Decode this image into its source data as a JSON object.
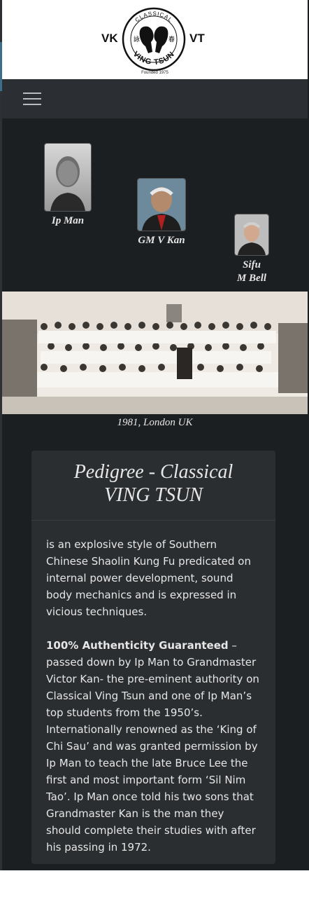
{
  "logo": {
    "left_text": "VK",
    "right_text": "VT",
    "seal_top_text": "CLASSICAL",
    "seal_bottom_text": "VING TSUN",
    "seal_char_left": "詠",
    "seal_char_right": "春",
    "founded": "Founded 1975"
  },
  "nav": {
    "menu_icon": "hamburger-menu-icon"
  },
  "portraits": [
    {
      "name_line1": "Ip Man",
      "name_line2": ""
    },
    {
      "name_line1": "GM V Kan",
      "name_line2": ""
    },
    {
      "name_line1": "Sifu",
      "name_line2": "M Bell"
    }
  ],
  "group_photo": {
    "caption": "1981, London UK"
  },
  "card": {
    "title_line1": "Pedigree - Classical",
    "title_line2": "VING TSUN",
    "intro": "is an explosive style of Southern Chinese Shaolin Kung Fu predicated on internal power development, sound body mechanics and is expressed in vicious techniques.",
    "guarantee_bold": "100% Authenticity Guaranteed",
    "guarantee_rest": " – passed down by Ip Man to Grandmaster Victor Kan- the pre-eminent authority on Classical Ving Tsun and one of Ip Man’s top students from the 1950’s. Internationally renowned as the ‘King of Chi Sau’ and was granted permission by Ip Man to teach the late Bruce Lee the first and most important form ‘Sil Nim Tao’. Ip Man once told his two sons that Grandmaster Kan is the man they should complete their studies with after his passing in 1972."
  },
  "colors": {
    "page_bg": "#1c1f22",
    "navbar_bg": "#2b2f33",
    "card_bg": "#2b2e31",
    "text": "#e6e6e6"
  }
}
